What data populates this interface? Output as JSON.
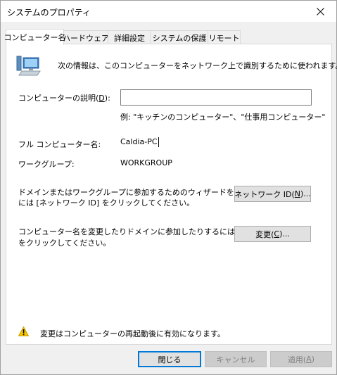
{
  "window": {
    "title": "システムのプロパティ"
  },
  "tabs": [
    {
      "label": "コンピューター名"
    },
    {
      "label": "ハードウェア"
    },
    {
      "label": "詳細設定"
    },
    {
      "label": "システムの保護"
    },
    {
      "label": "リモート"
    }
  ],
  "panel": {
    "intro_text": "次の情報は、このコンピューターをネットワーク上で識別するために使われます。",
    "description_label_prefix": "コンピューターの説明(",
    "description_label_key": "D",
    "description_label_suffix": "):",
    "description_value": "",
    "example_text": "例: \"キッチンのコンピューター\"、\"仕事用コンピューター\"",
    "full_name_label": "フル コンピューター名:",
    "full_name_value": "Caldia-PC",
    "workgroup_label": "ワークグループ:",
    "workgroup_value": "WORKGROUP",
    "network_text_line1": "ドメインまたはワークグループに参加するためのウィザードを使用する",
    "network_text_line2": "には [ネットワーク ID] をクリックしてください。",
    "network_button_prefix": "ネットワーク ID(",
    "network_button_key": "N",
    "network_button_suffix": ")...",
    "change_text_line1": "コンピューター名を変更したりドメインに参加したりするには [変更]",
    "change_text_line2": "をクリックしてください。",
    "change_button_prefix": "変更(",
    "change_button_key": "C",
    "change_button_suffix": ")...",
    "warning_text": "変更はコンピューターの再起動後に有効になります。"
  },
  "footer": {
    "close_label": "閉じる",
    "cancel_label": "キャンセル",
    "apply_prefix": "適用(",
    "apply_key": "A",
    "apply_suffix": ")"
  },
  "colors": {
    "accent": "#0078d7",
    "warning": "#f5c400"
  }
}
